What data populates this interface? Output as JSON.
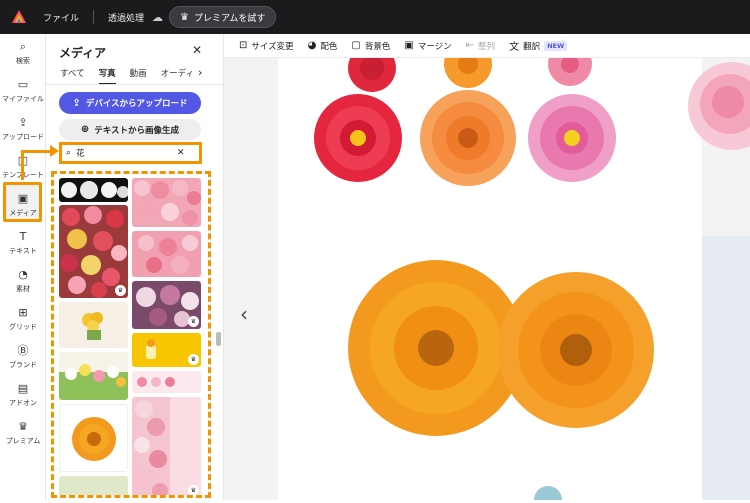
{
  "topbar": {
    "file_label": "ファイル",
    "process_label": "透過処理",
    "premium_label": "プレミアムを試す"
  },
  "rail": {
    "items": [
      {
        "label": "検索",
        "icon": "search-icon"
      },
      {
        "label": "マイファイル",
        "icon": "folder-icon"
      },
      {
        "label": "アップロード",
        "icon": "upload-icon"
      },
      {
        "label": "テンプレート",
        "icon": "template-icon"
      },
      {
        "label": "メディア",
        "icon": "media-icon"
      },
      {
        "label": "テキスト",
        "icon": "text-icon"
      },
      {
        "label": "素材",
        "icon": "shapes-icon"
      },
      {
        "label": "グリッド",
        "icon": "grid-icon"
      },
      {
        "label": "ブランド",
        "icon": "brand-icon"
      },
      {
        "label": "アドオン",
        "icon": "addon-icon"
      },
      {
        "label": "プレミアム",
        "icon": "crown-icon"
      }
    ]
  },
  "panel": {
    "title": "メディア",
    "tabs": [
      "すべて",
      "写真",
      "動画",
      "オーディ"
    ],
    "active_tab": "写真",
    "upload_label": "デバイスからアップロード",
    "generate_label": "テキストから画像生成",
    "search_value": "花"
  },
  "toolbar": {
    "tools": [
      {
        "label": "サイズ変更",
        "icon": "resize-icon"
      },
      {
        "label": "配色",
        "icon": "palette-icon"
      },
      {
        "label": "背景色",
        "icon": "background-color-icon"
      },
      {
        "label": "マージン",
        "icon": "margin-icon"
      },
      {
        "label": "整列",
        "icon": "align-icon"
      },
      {
        "label": "翻訳",
        "icon": "translate-icon"
      }
    ],
    "new_badge": "NEW"
  },
  "colors": {
    "accent_orange": "#f29400",
    "primary_blue": "#5258e4",
    "topbar_bg": "#1b1b1d"
  }
}
